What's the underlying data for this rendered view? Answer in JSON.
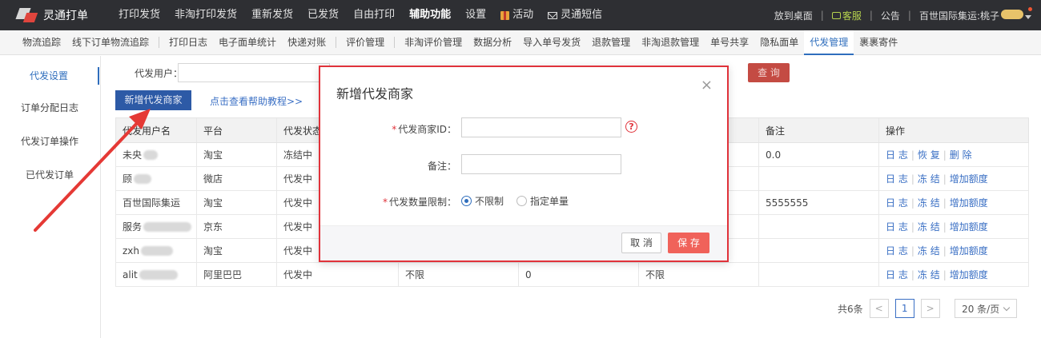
{
  "app": {
    "name": "灵通打单"
  },
  "nav": [
    {
      "label": "打印发货"
    },
    {
      "label": "非淘打印发货"
    },
    {
      "label": "重新发货"
    },
    {
      "label": "已发货"
    },
    {
      "label": "自由打印"
    },
    {
      "label": "辅助功能",
      "active": true
    },
    {
      "label": "设置"
    },
    {
      "label": "活动",
      "icon": "gift-icon"
    },
    {
      "label": "灵通短信",
      "icon": "envelope-icon"
    }
  ],
  "top_right": {
    "desktop": "放到桌面",
    "kefu": "客服",
    "notice": "公告",
    "user": "百世国际集运:桃子"
  },
  "subnav": [
    {
      "label": "物流追踪"
    },
    {
      "label": "线下订单物流追踪"
    },
    {
      "divider": true
    },
    {
      "label": "打印日志"
    },
    {
      "label": "电子面单统计"
    },
    {
      "label": "快递对账"
    },
    {
      "divider": true
    },
    {
      "label": "评价管理"
    },
    {
      "divider": true
    },
    {
      "label": "非淘评价管理"
    },
    {
      "label": "数据分析"
    },
    {
      "label": "导入单号发货"
    },
    {
      "label": "退款管理"
    },
    {
      "label": "非淘退款管理"
    },
    {
      "label": "单号共享"
    },
    {
      "label": "隐私面单"
    },
    {
      "label": "代发管理",
      "active": true
    },
    {
      "label": "裹裹寄件"
    }
  ],
  "sidebar": [
    {
      "label": "代发设置",
      "active": true
    },
    {
      "label": "订单分配日志"
    },
    {
      "label": "代发订单操作"
    },
    {
      "label": "已代发订单"
    }
  ],
  "filter": {
    "label": "代发用户：",
    "query_label": "查 询"
  },
  "actions": {
    "add_label": "新增代发商家",
    "help_label": "点击查看帮助教程>>"
  },
  "table": {
    "headers": [
      "代发用户名",
      "平台",
      "代发状态",
      "",
      "",
      "",
      "备注",
      "操作"
    ],
    "rows": [
      {
        "user": "未央",
        "platform": "淘宝",
        "status": "冻结中",
        "c4": "",
        "c5": "",
        "c6": "",
        "remark": "0.0",
        "ops": [
          "日 志",
          "恢 复",
          "删 除"
        ]
      },
      {
        "user": "顾",
        "platform": "微店",
        "status": "代发中",
        "c4": "",
        "c5": "",
        "c6": "",
        "remark": "",
        "ops": [
          "日 志",
          "冻 结",
          "增加额度"
        ]
      },
      {
        "user": "百世国际集运",
        "platform": "淘宝",
        "status": "代发中",
        "c4": "",
        "c5": "",
        "c6": "",
        "remark": "5555555",
        "ops": [
          "日 志",
          "冻 结",
          "增加额度"
        ]
      },
      {
        "user": "服务",
        "platform": "京东",
        "status": "代发中",
        "c4": "",
        "c5": "",
        "c6": "",
        "remark": "",
        "ops": [
          "日 志",
          "冻 结",
          "增加额度"
        ]
      },
      {
        "user": "zxh",
        "platform": "淘宝",
        "status": "代发中",
        "c4": "",
        "c5": "",
        "c6": "",
        "remark": "",
        "ops": [
          "日 志",
          "冻 结",
          "增加额度"
        ]
      },
      {
        "user": "alit",
        "platform": "阿里巴巴",
        "status": "代发中",
        "c4": "不限",
        "c5": "0",
        "c6": "不限",
        "remark": "",
        "ops": [
          "日 志",
          "冻 结",
          "增加额度"
        ]
      }
    ]
  },
  "pager": {
    "total": "共6条",
    "current": "1",
    "page_size": "20 条/页"
  },
  "modal": {
    "title": "新增代发商家",
    "close": "×",
    "fields": {
      "merchant_id_label": "代发商家ID",
      "merchant_id_value": "",
      "remark_label": "备注",
      "remark_value": "",
      "limit_label": "代发数量限制",
      "limit_options": [
        "不限制",
        "指定单量"
      ],
      "limit_selected": "不限制"
    },
    "help": "?",
    "cancel_label": "取 消",
    "save_label": "保 存"
  },
  "colors": {
    "topbar": "#2e2f33",
    "accent": "#2f6ebd",
    "primary_button": "#2d5aa6",
    "danger": "#e0323a",
    "save": "#f0625a"
  }
}
